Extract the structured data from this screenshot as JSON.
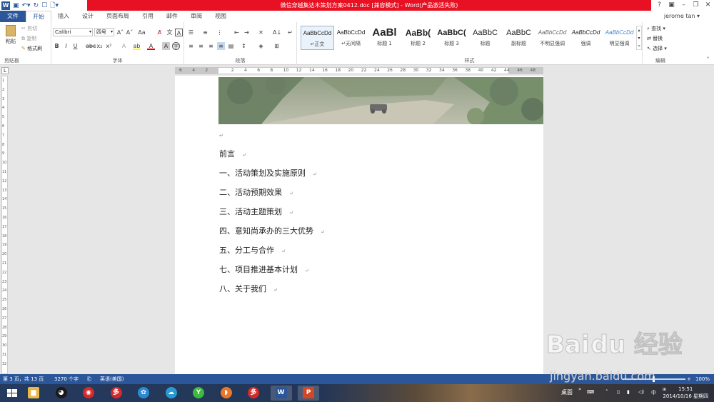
{
  "title_bar": {
    "title": "微信穿越集达木策划方案0412.doc [兼容模式] - Word(产品激活失败)",
    "controls": [
      "?",
      "▣",
      "–",
      "❐",
      "✕"
    ]
  },
  "tabs": {
    "file": "文件",
    "items": [
      "开始",
      "插入",
      "设计",
      "页面布局",
      "引用",
      "邮件",
      "审阅",
      "视图"
    ],
    "active": "开始",
    "user": "jerome tan"
  },
  "ribbon": {
    "clipboard": {
      "label": "剪贴板",
      "paste": "粘贴",
      "cut": "剪切",
      "copy": "复制",
      "format_painter": "格式刷"
    },
    "font": {
      "label": "字体",
      "font_name": "Calibri",
      "font_size": "四号"
    },
    "paragraph": {
      "label": "段落"
    },
    "styles": {
      "label": "样式",
      "items": [
        {
          "preview": "AaBbCcDd",
          "name": "↵正文"
        },
        {
          "preview": "AaBbCcDd",
          "name": "↵无间隔"
        },
        {
          "preview": "AaBl",
          "name": "标题 1"
        },
        {
          "preview": "AaBb(",
          "name": "标题 2"
        },
        {
          "preview": "AaBbC(",
          "name": "标题 3"
        },
        {
          "preview": "AaBbC",
          "name": "标题"
        },
        {
          "preview": "AaBbC",
          "name": "副标题"
        },
        {
          "preview": "AaBbCcDd",
          "name": "不明显强调"
        },
        {
          "preview": "AaBbCcDd",
          "name": "强调"
        },
        {
          "preview": "AaBbCcDd",
          "name": "明显强调"
        }
      ]
    },
    "editing": {
      "label": "编辑",
      "find": "查找",
      "replace": "替换",
      "select": "选择"
    }
  },
  "ruler": {
    "h_numbers": [
      "6",
      "4",
      "2",
      "",
      "2",
      "4",
      "6",
      "8",
      "10",
      "12",
      "14",
      "16",
      "18",
      "20",
      "22",
      "24",
      "26",
      "28",
      "30",
      "32",
      "34",
      "36",
      "38",
      "40",
      "42",
      "44",
      "46",
      "48"
    ],
    "v_numbers": [
      "1",
      "2",
      "3",
      "4",
      "5",
      "6",
      "7",
      "8",
      "9",
      "10",
      "11",
      "12",
      "13",
      "14",
      "15",
      "16",
      "17",
      "18",
      "19",
      "20",
      "21",
      "22",
      "23",
      "24",
      "25",
      "26",
      "27",
      "28",
      "29",
      "30",
      "31",
      "32"
    ]
  },
  "document": {
    "toc": [
      "前言",
      "一、活动策划及实施原则",
      "二、活动预期效果",
      "三、活动主题策划",
      "四、意知尚承办的三大优势",
      "五、分工与合作",
      "七、项目推进基本计划",
      "八、关于我们"
    ],
    "mark": "↵"
  },
  "status_bar": {
    "page": "第 3 页，共 13 页",
    "words": "3270 个字",
    "language": "英语(美国)",
    "zoom": "100%"
  },
  "taskbar": {
    "desktop": "桌面",
    "ime": "中",
    "time": "15:51",
    "date": "2014/10/16 星期四",
    "apps": [
      {
        "name": "file-explorer",
        "color": "#e8b84a",
        "glyph": "▆"
      },
      {
        "name": "qq",
        "color": "#1a1a1a",
        "glyph": "◕"
      },
      {
        "name": "netease-music",
        "color": "#d42a2a",
        "glyph": "◉"
      },
      {
        "name": "app-red-1",
        "color": "#d42a2a",
        "glyph": "多"
      },
      {
        "name": "app-blue-1",
        "color": "#2a8ad4",
        "glyph": "✿"
      },
      {
        "name": "cloud",
        "color": "#2a9ad4",
        "glyph": "☁"
      },
      {
        "name": "iqiyi",
        "color": "#3cba3c",
        "glyph": "Y"
      },
      {
        "name": "app-orange",
        "color": "#e8772a",
        "glyph": "◗"
      },
      {
        "name": "app-red-2",
        "color": "#d42a2a",
        "glyph": "多"
      },
      {
        "name": "word",
        "color": "#2b579a",
        "glyph": "W"
      },
      {
        "name": "powerpoint",
        "color": "#d24726",
        "glyph": "P"
      }
    ]
  },
  "watermark": {
    "logo": "Bai du 经验",
    "url": "jingyan.baidu.com"
  }
}
